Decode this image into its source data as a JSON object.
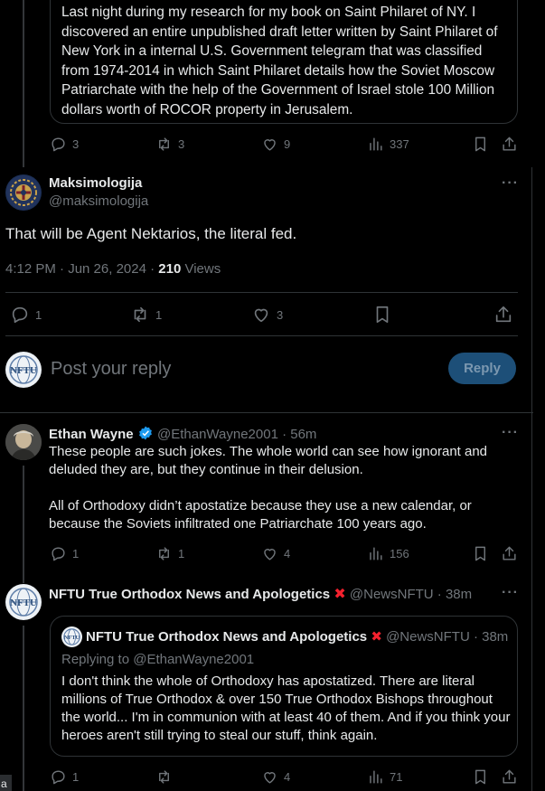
{
  "top_quote": {
    "text": "Last night during my research for my book on Saint Philaret of NY. I discovered an entire unpublished draft letter written by Saint Philaret of New York in a internal U.S. Government telegram that was classified from 1974-2014 in which Saint Philaret details how the Soviet Moscow Patriarchate with the help of the Government of Israel stole 100 Million dollars worth of ROCOR property in Jerusalem.",
    "replies": "3",
    "reposts": "3",
    "likes": "9",
    "views": "337"
  },
  "focused_post": {
    "author_name": "Maksimologija",
    "author_handle": "@maksimologija",
    "text": "That will be Agent Nektarios, the literal fed.",
    "timestamp": "4:12 PM · Jun 26, 2024 · ",
    "views_count": "210",
    "views_label": " Views",
    "replies": "1",
    "reposts": "1",
    "likes": "3"
  },
  "composer": {
    "placeholder": "Post your reply",
    "reply_label": "Reply"
  },
  "reply1": {
    "author_name": "Ethan Wayne",
    "author_handle": "@EthanWayne2001",
    "time": " · 56m",
    "paragraph1": "These people are such jokes. The whole world can see how ignorant and deluded they are, but they continue in their delusion.",
    "paragraph2": "All of Orthodoxy didn’t apostatize because they use a new calendar, or because the Soviets infiltrated one Patriarchate 100 years ago.",
    "replies": "1",
    "reposts": "1",
    "likes": "4",
    "views": "156"
  },
  "reply2": {
    "author_name": "NFTU True Orthodox News and Apologetics",
    "author_handle": "@NewsNFTU",
    "time": " · 38m",
    "quote_author_name": "NFTU True Orthodox News and Apologetics",
    "quote_author_handle": "@NewsNFTU",
    "quote_time": " · 38m",
    "quote_replying_prefix": "Replying to ",
    "quote_replying_handle": "@EthanWayne2001",
    "quote_text": "I don't think the whole of Orthodoxy has apostatized. There are literal millions of True Orthodox & over 150 True Orthodox Bishops throughout the world... I'm in communion with at least 40 of them. And if you think your heroes aren't still trying to steal our stuff, think again.",
    "replies": "1",
    "likes": "4",
    "views": "71"
  },
  "edge_label": "a",
  "colors": {
    "background": "#000000",
    "text": "#e7e9ea",
    "muted": "#71767b",
    "border": "#2f3336",
    "verified": "#1d9bf0",
    "reply_button": "#1d4f78",
    "x_mark": "#f4212e"
  }
}
